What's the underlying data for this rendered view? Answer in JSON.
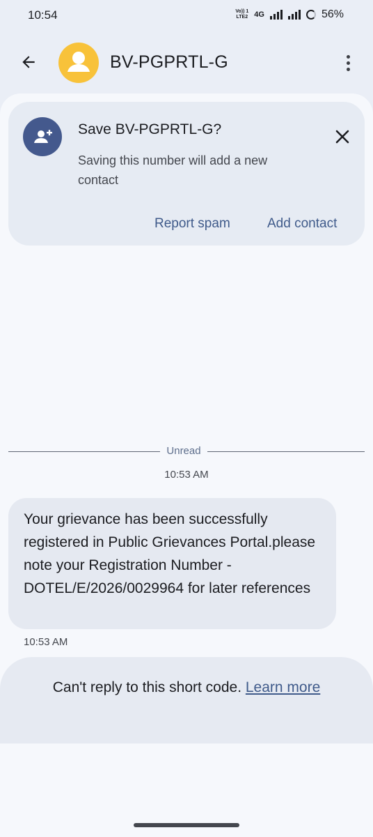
{
  "status_bar": {
    "time": "10:54",
    "volte_top": "Vo)) 1",
    "volte_bottom": "LTE2",
    "network": "4G",
    "battery": "56%"
  },
  "app_bar": {
    "contact_name": "BV-PGPRTL-G",
    "avatar_color": "#f8c23a"
  },
  "save_card": {
    "title": "Save BV-PGPRTL-G?",
    "subtitle": "Saving this number will add a new contact",
    "report_spam": "Report spam",
    "add_contact": "Add contact"
  },
  "conversation": {
    "divider_label": "Unread",
    "timestamp": "10:53 AM",
    "message": {
      "text": "Your grievance has been successfully registered in Public Grievances Portal.please note your Registration Number - DOTEL/E/2026/0029964 for later references",
      "time": "10:53 AM"
    }
  },
  "footer": {
    "text": "Can't reply to this short code.",
    "link": "Learn more"
  },
  "colors": {
    "accent": "#3f5a8a",
    "card_icon_bg": "#44598d"
  }
}
